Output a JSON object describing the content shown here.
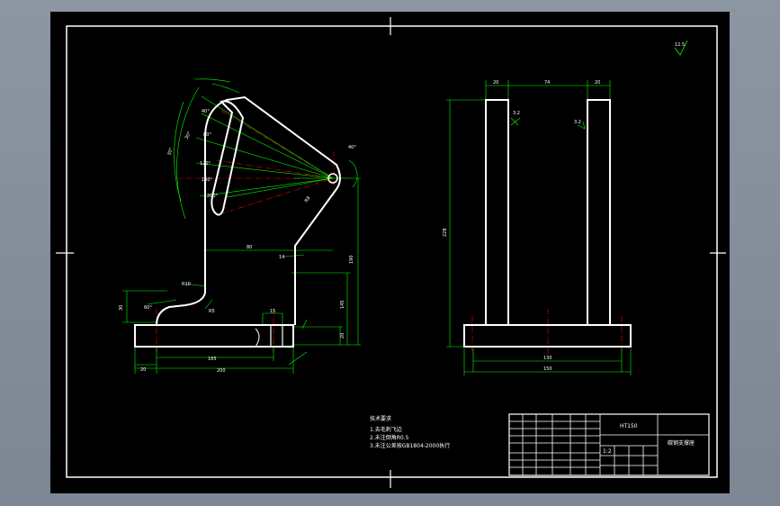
{
  "colors": {
    "background": "#000000",
    "outline": "#ffffff",
    "dimension": "#00ff00",
    "centerline": "#ff0000",
    "frame_bg": "#8c96a2"
  },
  "front_view": {
    "dims": {
      "base_thk": "20",
      "base_left": "20",
      "base_mid": "165",
      "overall_w": "200",
      "hole_w": "15",
      "slot_dia": "14",
      "pivot_r": "R8",
      "height_to_step": "145",
      "height_to_pivot": "190",
      "arm_offset": "80",
      "fillet_r": "R10",
      "small_r": "R5",
      "left_h": "30",
      "angle_small": "60°"
    },
    "slot_marks": [
      "40°",
      "80°",
      "120°",
      "160°",
      "200°"
    ],
    "angle_labels": [
      "30°",
      "30°",
      "40°"
    ]
  },
  "side_view": {
    "dims": {
      "top_left": "20",
      "top_mid": "74",
      "top_right": "20",
      "height": "228",
      "base_inner": "130",
      "base_outer": "150"
    },
    "roughness_marks": [
      "3.2",
      "3.2"
    ]
  },
  "roughness_top": "12.5",
  "notes": {
    "title": "技术要求",
    "lines": [
      "1.去毛刺飞边",
      "2.未注倒角R0.5",
      "3.未注公差按GB1804-2000执行"
    ]
  },
  "title_block": {
    "material": "HT150",
    "part_name": "碳钢支撑座",
    "scale": "1:2"
  }
}
